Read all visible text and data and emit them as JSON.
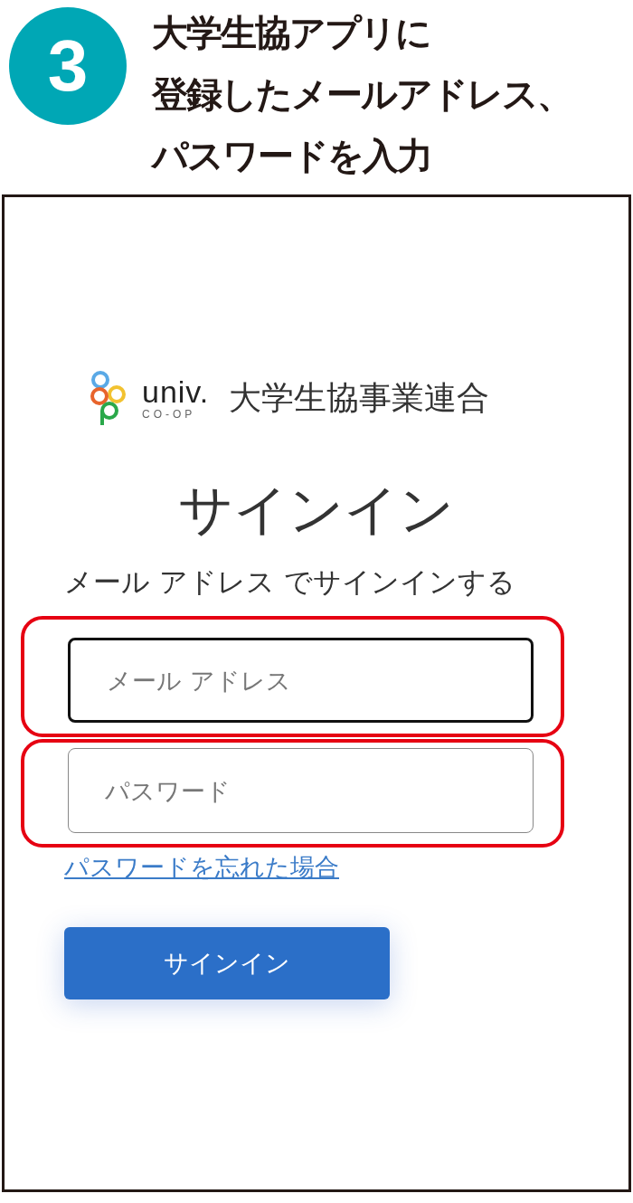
{
  "step": {
    "number": "3",
    "title_lines": [
      "大学生協アプリに",
      "登録したメールアドレス、",
      "パスワードを入力"
    ]
  },
  "screen": {
    "logo": {
      "wordmark": "univ.",
      "sub": "CO-OP",
      "org": "大学生協事業連合"
    },
    "title": "サインイン",
    "subtitle": "メール アドレス でサインインする",
    "fields": [
      {
        "placeholder": "メール アドレス",
        "focused": true,
        "highlighted": true
      },
      {
        "placeholder": "パスワード",
        "focused": false,
        "highlighted": true
      }
    ],
    "link": "パスワードを忘れた場合",
    "button": "サインイン"
  }
}
